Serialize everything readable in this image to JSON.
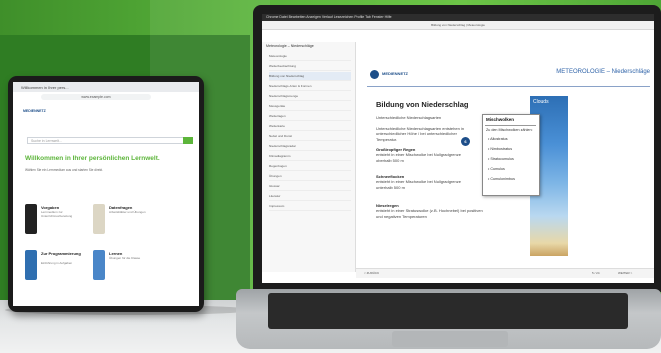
{
  "tablet": {
    "browser_tab": "Willkommen in Ihrer pers...",
    "url": "www.example.com",
    "logo": "MEDIENNETZ",
    "search_placeholder": "Suche in Lernwelt...",
    "welcome": "Willkommen in Ihrer persönlichen Lernwelt.",
    "welcome_sub": "Wählen Sie ein Lernmedium aus und starten Sie direkt.",
    "cards": [
      {
        "title": "Vorgaben",
        "text": "Lernmedium zur Unterrichtsvorbereitung"
      },
      {
        "title": "Datenfragen",
        "text": "Arbeitsblätter und Übungen"
      },
      {
        "title": "Zur Programmierung",
        "text": "Einführung in Aufgaben"
      },
      {
        "title": "Lernen",
        "text": "Übungen für die Klasse"
      }
    ]
  },
  "laptop": {
    "system_bar": "Chrome  Datei  Bearbeiten  Anzeigen  Verlauf  Lesezeichen  Profile  Tab  Fenster  Hilfe",
    "tab_title": "Bildung von Niederschlag | Meteorologie",
    "sidebar_head": "Meteorologie – Niederschläge",
    "sidebar_items": [
      "Meteorologie",
      "Wetterbeobachtung",
      "Bildung von Niederschlag",
      "Niederschlags-Arten & Formen",
      "Niederschlagsmenge",
      "Messgeräte",
      "Wetterlagen",
      "Wetterkarte",
      "Nebel und Dunst",
      "Niederschlagsradar",
      "Klimadiagramm",
      "Regenbogen",
      "Übungen",
      "Glossar",
      "Literatur",
      "Impressum"
    ],
    "logo": "MEDIENNETZ",
    "course_title": "METEOROLOGIE – Niederschläge",
    "heading": "Bildung von Niederschlag",
    "intro_label": "Unterschiedliche Niederschlagsarten",
    "intro_text": "Unterschiedliche Niederschlagsarten entstehen in unterschiedlicher Höhe / bei unterschiedlicher Temperatur.",
    "sections": [
      {
        "title": "Großtropfiger Regen",
        "text": "entsteht in einer Mischwolke bei Nullgradgrenze oberhalb 500 m"
      },
      {
        "title": "Schneeflocken",
        "text": "entsteht in einer Mischwolke bei Nullgradgrenze unterhalb 500 m"
      },
      {
        "title": "Nieselregen",
        "text": "entsteht in einer Stratuswolke (z.B. Hochnebel) bei positiven und negativen Temperaturen"
      }
    ],
    "badge_number": "6",
    "popup": {
      "title": "Mischwolken",
      "intro": "Zu den Mischwolken zählen:",
      "items": [
        "Altostratus",
        "Nimbostratus",
        "Stratocumulus",
        "Cumulus",
        "Cumulonimbus"
      ]
    },
    "image_label": "Clouds",
    "footer_left": "< ZURÜCK",
    "footer_right": "WEITER >",
    "page_counter": "5 / 24"
  }
}
